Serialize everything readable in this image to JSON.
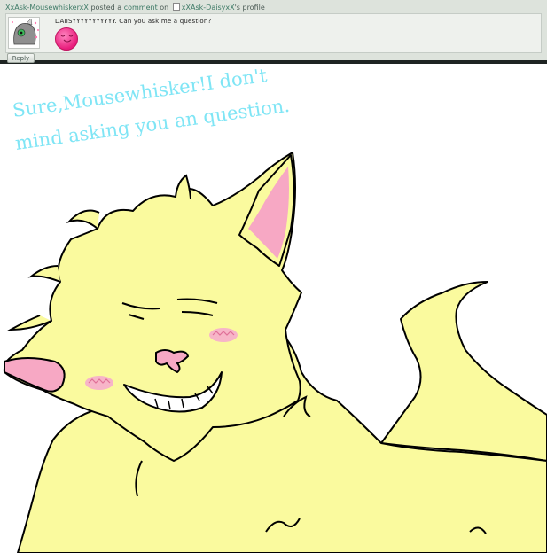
{
  "notification": {
    "author": "XxAsk-MousewhiskerxX",
    "posted_text": " posted a ",
    "comment_link": "comment",
    "on_text": " on ",
    "target": "xXAsk-DaisyxX",
    "profile_suffix": "'s profile"
  },
  "comment": {
    "text": "DAIISYYYYYYYYYYY. Can you ask me a question?",
    "emoticon": "pink-blush-smiley"
  },
  "reply_button": {
    "label": "Reply"
  },
  "artwork": {
    "caption_line1": "Sure,Mousewhisker!I don't",
    "caption_line2": "mind asking you an question.",
    "caption_color": "#7fe5f5",
    "cat_fur_color": "#fafa9e",
    "ear_color": "#f7a8c4",
    "blush_color": "#f7b5c8"
  }
}
